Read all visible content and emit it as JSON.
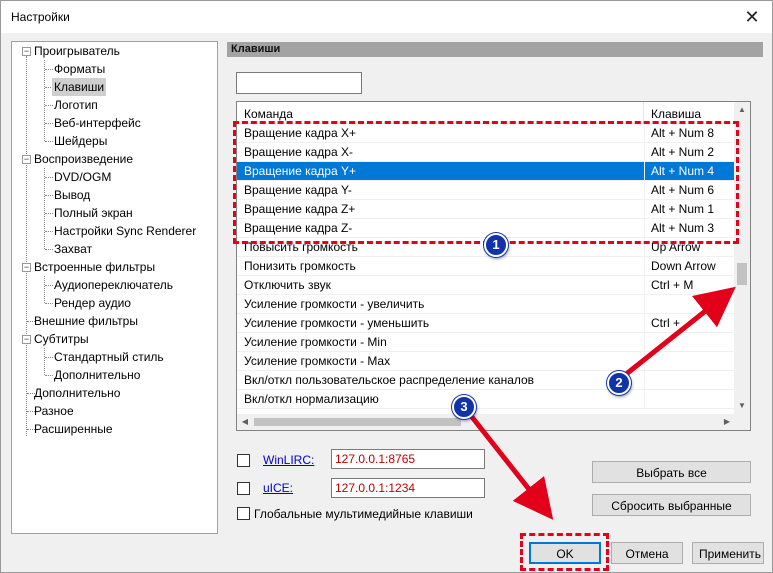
{
  "window": {
    "title": "Настройки"
  },
  "tree": {
    "items": [
      "Проигрыватель",
      "Форматы",
      "Клавиши",
      "Логотип",
      "Веб-интерфейс",
      "Шейдеры",
      "Воспроизведение",
      "DVD/OGM",
      "Вывод",
      "Полный экран",
      "Настройки Sync Renderer",
      "Захват",
      "Встроенные фильтры",
      "Аудиопереключатель",
      "Рендер аудио",
      "Внешние фильтры",
      "Субтитры",
      "Стандартный стиль",
      "Дополнительно",
      "Дополнительно",
      "Разное",
      "Расширенные"
    ],
    "selected": "Клавиши"
  },
  "panel": {
    "title": "Клавиши"
  },
  "filter": {
    "value": ""
  },
  "table": {
    "headers": {
      "command": "Команда",
      "key": "Клавиша"
    },
    "rows": [
      {
        "command": "Вращение кадра X+",
        "key": "Alt + Num 8"
      },
      {
        "command": "Вращение кадра X-",
        "key": "Alt + Num 2"
      },
      {
        "command": "Вращение кадра Y+",
        "key": "Alt + Num 4"
      },
      {
        "command": "Вращение кадра Y-",
        "key": "Alt + Num 6"
      },
      {
        "command": "Вращение кадра Z+",
        "key": "Alt + Num 1"
      },
      {
        "command": "Вращение кадра Z-",
        "key": "Alt + Num 3"
      },
      {
        "command": "Повысить громкость",
        "key": "Up Arrow"
      },
      {
        "command": "Понизить громкость",
        "key": "Down Arrow"
      },
      {
        "command": "Отключить звук",
        "key": "Ctrl + M"
      },
      {
        "command": "Усиление громкости - увеличить",
        "key": ""
      },
      {
        "command": "Усиление громкости - уменьшить",
        "key": "Ctrl +"
      },
      {
        "command": "Усиление громкости - Min",
        "key": ""
      },
      {
        "command": "Усиление громкости - Max",
        "key": ""
      },
      {
        "command": "Вкл/откл пользовательское распределение каналов",
        "key": ""
      },
      {
        "command": "Вкл/откл нормализацию",
        "key": ""
      }
    ],
    "selected_row": 2
  },
  "remote": {
    "winlirc": {
      "label": "WinLIRC:",
      "address": "127.0.0.1:8765"
    },
    "uice": {
      "label": "uICE:",
      "address": "127.0.0.1:1234"
    },
    "global_keys_label": "Глобальные мультимедийные клавиши"
  },
  "buttons": {
    "select_all": "Выбрать все",
    "reset_selected": "Сбросить выбранные",
    "ok": "OK",
    "cancel": "Отмена",
    "apply": "Применить"
  },
  "annotations": {
    "marker1": "1",
    "marker2": "2",
    "marker3": "3",
    "color": "#e3001b",
    "marker_color": "#1133aa"
  },
  "colors": {
    "selection": "#0078d7",
    "link": "#0000cc",
    "address_text": "#c00000"
  }
}
